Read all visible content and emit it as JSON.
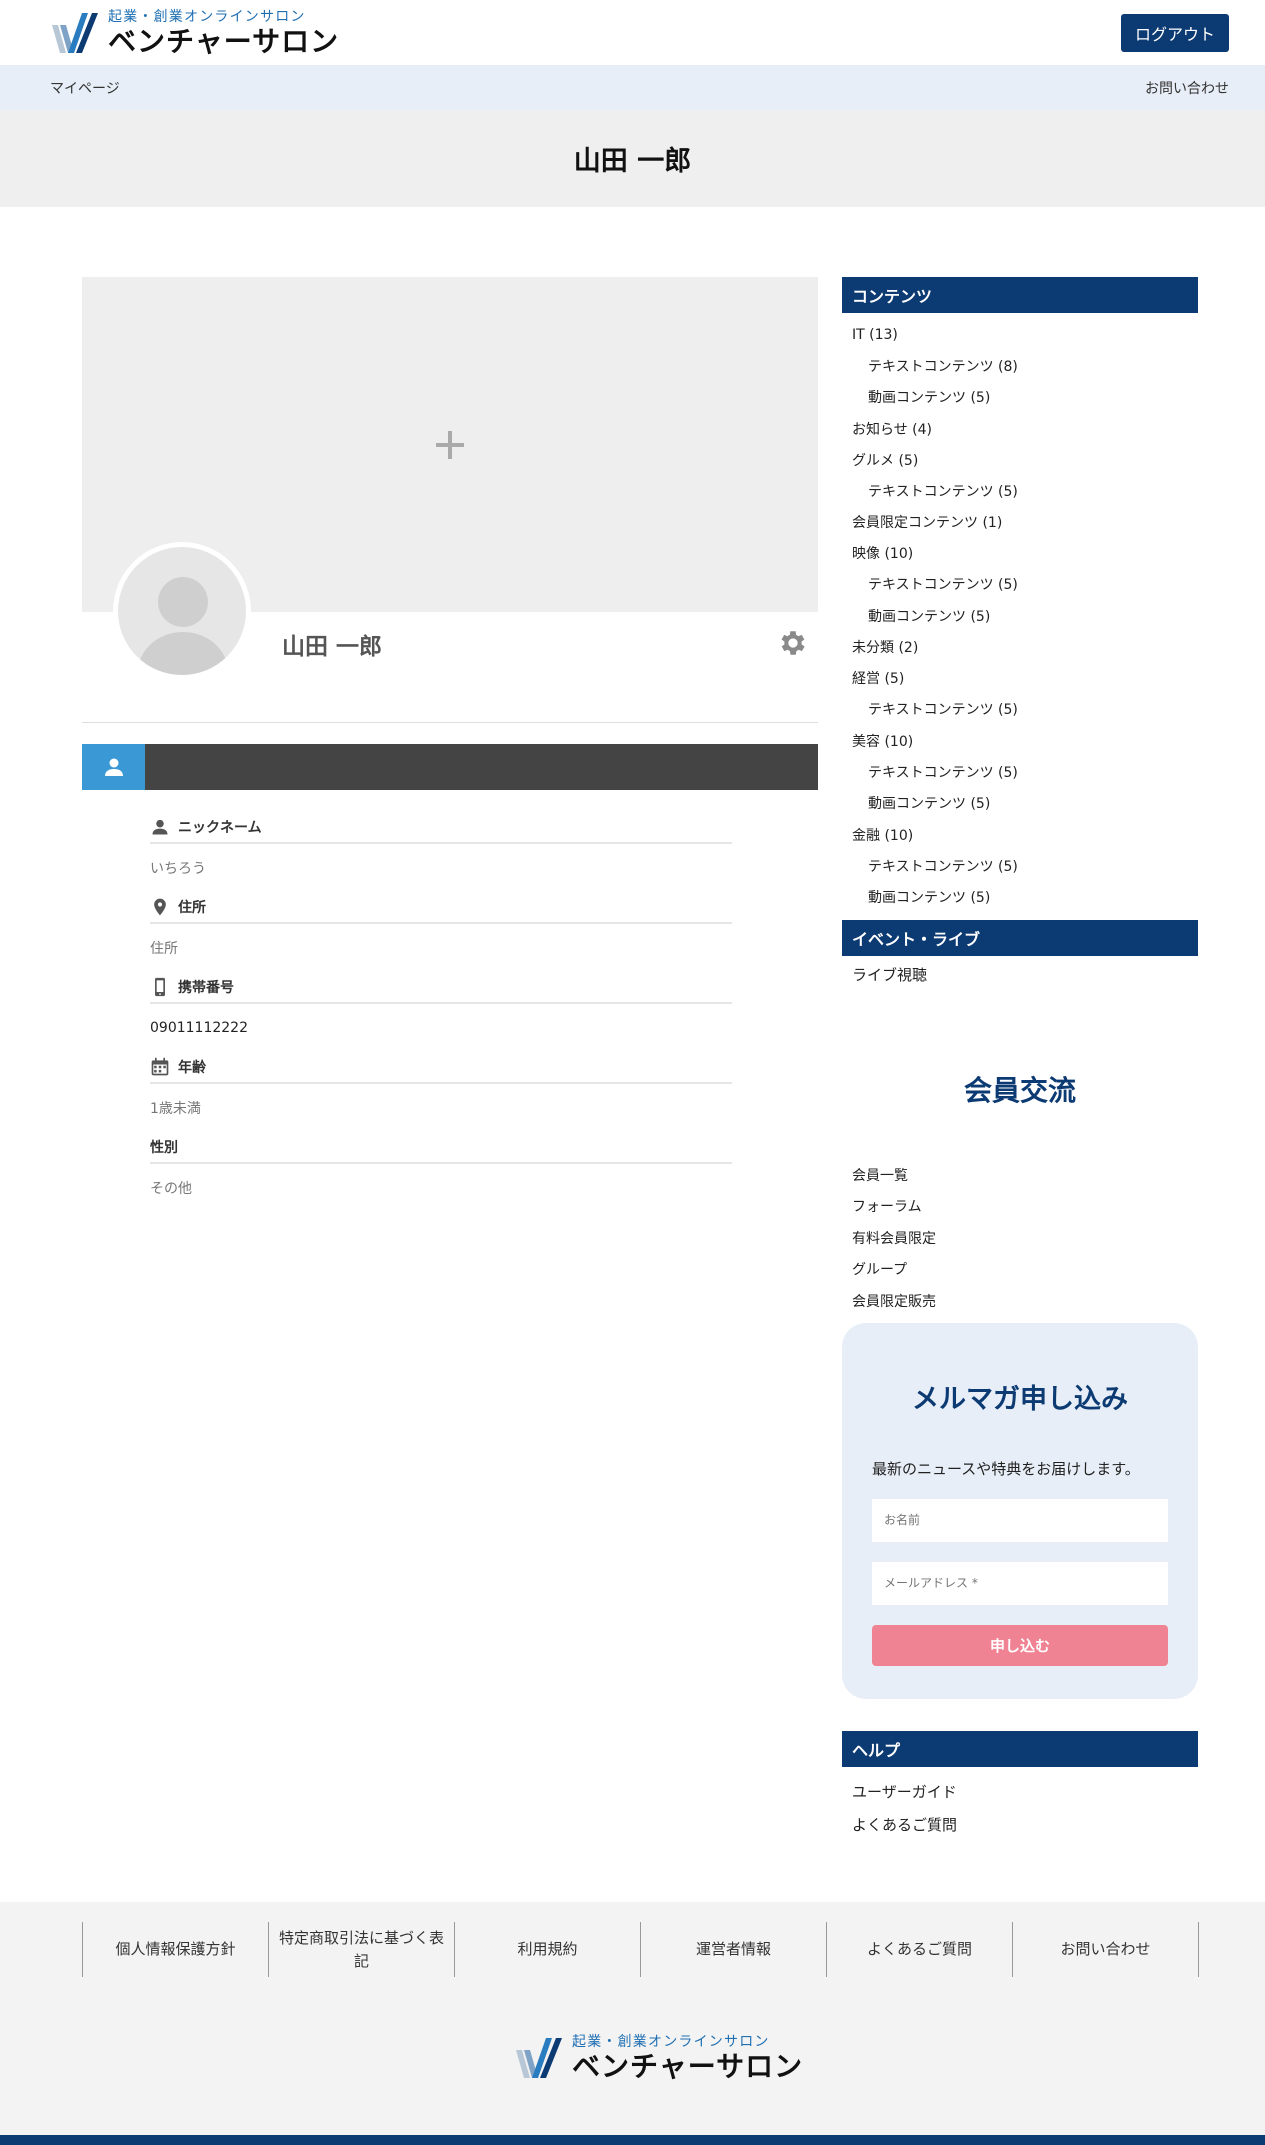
{
  "header": {
    "logo_sub": "起業・創業オンラインサロン",
    "logo_main": "ベンチャーサロン",
    "logout": "ログアウト"
  },
  "subnav": {
    "left": "マイページ",
    "right": "お問い合わせ"
  },
  "page_title": "山田 一郎",
  "profile": {
    "name": "山田 一郎",
    "fields": [
      {
        "label": "ニックネーム",
        "value": "いちろう",
        "icon": "person-icon"
      },
      {
        "label": "住所",
        "value": "住所",
        "icon": "location-pin-icon"
      },
      {
        "label": "携帯番号",
        "value": "09011112222",
        "icon": "mobile-phone-icon"
      },
      {
        "label": "年齢",
        "value": "1歳未満",
        "icon": "calendar-icon"
      },
      {
        "label": "性別",
        "value": "その他",
        "icon": ""
      }
    ]
  },
  "sidebar": {
    "contents_title": "コンテンツ",
    "categories": [
      {
        "label": "IT (13)",
        "sub": false
      },
      {
        "label": "テキストコンテンツ (8)",
        "sub": true
      },
      {
        "label": "動画コンテンツ (5)",
        "sub": true
      },
      {
        "label": "お知らせ (4)",
        "sub": false
      },
      {
        "label": "グルメ (5)",
        "sub": false
      },
      {
        "label": "テキストコンテンツ (5)",
        "sub": true
      },
      {
        "label": "会員限定コンテンツ (1)",
        "sub": false
      },
      {
        "label": "映像 (10)",
        "sub": false
      },
      {
        "label": "テキストコンテンツ (5)",
        "sub": true
      },
      {
        "label": "動画コンテンツ (5)",
        "sub": true
      },
      {
        "label": "未分類 (2)",
        "sub": false
      },
      {
        "label": "経営 (5)",
        "sub": false
      },
      {
        "label": "テキストコンテンツ (5)",
        "sub": true
      },
      {
        "label": "美容 (10)",
        "sub": false
      },
      {
        "label": "テキストコンテンツ (5)",
        "sub": true
      },
      {
        "label": "動画コンテンツ (5)",
        "sub": true
      },
      {
        "label": "金融 (10)",
        "sub": false
      },
      {
        "label": "テキストコンテンツ (5)",
        "sub": true
      },
      {
        "label": "動画コンテンツ (5)",
        "sub": true
      }
    ],
    "event_title": "イベント・ライブ",
    "event_item": "ライブ視聴",
    "member_title": "会員交流",
    "member_items": [
      "会員一覧",
      "フォーラム",
      "有料会員限定",
      "グループ",
      "会員限定販売"
    ],
    "newsletter": {
      "title": "メルマガ申し込み",
      "desc": "最新のニュースや特典をお届けします。",
      "name_placeholder": "お名前",
      "email_placeholder": "メールアドレス *",
      "submit": "申し込む"
    },
    "help_title": "ヘルプ",
    "help_items": [
      "ユーザーガイド",
      "よくあるご質問"
    ]
  },
  "footer": {
    "links": [
      "個人情報保護方針",
      "特定商取引法に基づく表記",
      "利用規約",
      "運営者情報",
      "よくあるご質問",
      "お問い合わせ"
    ],
    "logo_sub": "起業・創業オンラインサロン",
    "logo_main": "ベンチャーサロン"
  },
  "colors": {
    "brand": "#0c3a73",
    "accent": "#3a98d4",
    "submit": "#ef8293",
    "light": "#e8eef7"
  }
}
